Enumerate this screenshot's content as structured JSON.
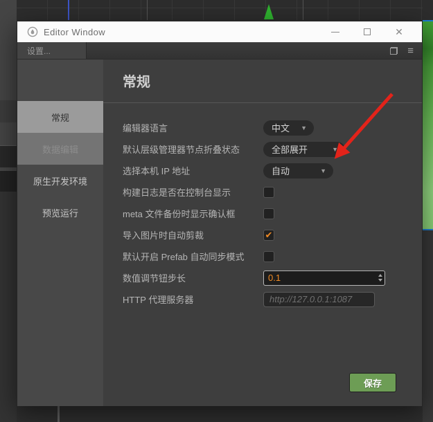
{
  "window": {
    "title": "Editor Window"
  },
  "tabbar": {
    "active_tab": "设置..."
  },
  "sidebar": {
    "items": [
      {
        "label": "常规",
        "state": "selected"
      },
      {
        "label": "数据编辑",
        "state": "disabled"
      },
      {
        "label": "原生开发环境",
        "state": "normal"
      },
      {
        "label": "预览运行",
        "state": "normal"
      }
    ]
  },
  "main": {
    "heading": "常规",
    "rows": [
      {
        "label": "编辑器语言",
        "type": "dropdown",
        "value": "中文"
      },
      {
        "label": "默认层级管理器节点折叠状态",
        "type": "dropdown",
        "value": "全部展开"
      },
      {
        "label": "选择本机 IP 地址",
        "type": "dropdown",
        "value": "自动"
      },
      {
        "label": "构建日志是否在控制台显示",
        "type": "checkbox",
        "checked": false
      },
      {
        "label": "meta 文件备份时显示确认框",
        "type": "checkbox",
        "checked": false
      },
      {
        "label": "导入图片时自动剪裁",
        "type": "checkbox",
        "checked": true
      },
      {
        "label": "默认开启 Prefab 自动同步模式",
        "type": "checkbox",
        "checked": false
      },
      {
        "label": "数值调节钮步长",
        "type": "number",
        "value": "0.1"
      },
      {
        "label": "HTTP 代理服务器",
        "type": "text",
        "placeholder": "http://127.0.0.1:1087"
      }
    ],
    "save_label": "保存"
  },
  "icons": {
    "caret": "▼",
    "check": "✔",
    "close": "✕",
    "menu": "≡"
  },
  "colors": {
    "accent_orange": "#F08A24",
    "save_green": "#6D9D55",
    "annotation_arrow_red": "#E3231A",
    "selected_item_bg": "#9B9B9B",
    "sprite_green_top": "#41A135",
    "sprite_green_bottom": "#8BD178",
    "gizmo_green": "#2FB32F"
  },
  "annotation": {
    "type": "red-arrow-pointing-at-collapse-state-dropdown"
  }
}
